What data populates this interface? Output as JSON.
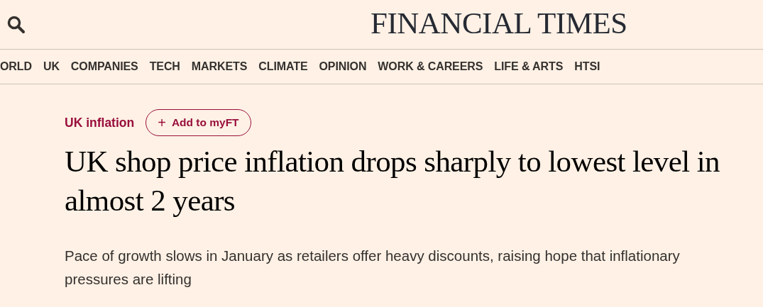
{
  "masthead": {
    "title": "FINANCIAL TIMES"
  },
  "nav": [
    "ORLD",
    "UK",
    "COMPANIES",
    "TECH",
    "MARKETS",
    "CLIMATE",
    "OPINION",
    "WORK & CAREERS",
    "LIFE & ARTS",
    "HTSI"
  ],
  "article": {
    "topic": "UK inflation",
    "follow_button": {
      "icon": "+",
      "label": "Add to myFT"
    },
    "headline": "UK shop price inflation drops sharply to lowest level in almost 2 years",
    "standfirst": "Pace of growth slows in January as retailers offer heavy discounts, raising hope that inflationary pressures are lifting"
  }
}
